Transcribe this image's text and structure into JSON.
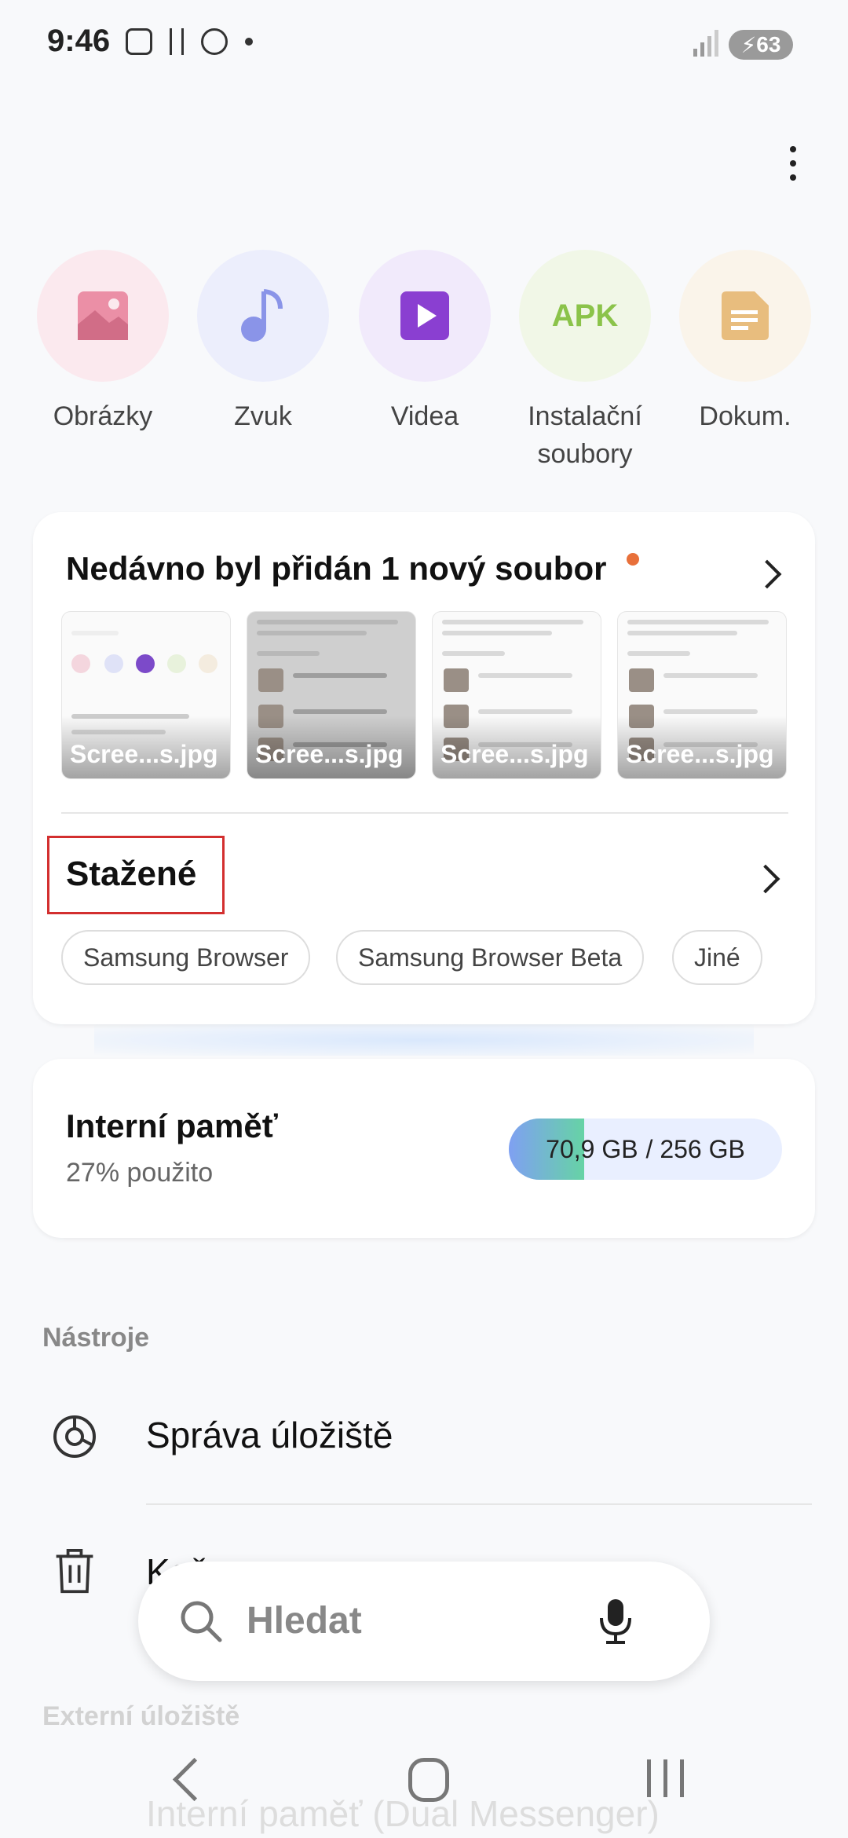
{
  "status_bar": {
    "time": "9:46",
    "battery": "63"
  },
  "categories": [
    {
      "label": "Obrázky",
      "icon": "image-icon",
      "bg": "#fbe9ee",
      "color": "#e8869c"
    },
    {
      "label": "Zvuk",
      "icon": "music-note-icon",
      "bg": "#eceefc",
      "color": "#8a94e8"
    },
    {
      "label": "Videa",
      "icon": "video-icon",
      "bg": "#f1eafb",
      "color": "#8a3fd1"
    },
    {
      "label": "Instalační\nsoubory",
      "icon": "apk-icon",
      "apk_text": "APK",
      "bg": "#f1f7e7",
      "color": "#8bc34a"
    },
    {
      "label": "Dokum.",
      "icon": "document-icon",
      "bg": "#faf4ea",
      "color": "#e8bd7e"
    }
  ],
  "recent": {
    "title": "Nedávno byl přidán 1 nový soubor",
    "thumbs": [
      {
        "caption": "Scree...s.jpg"
      },
      {
        "caption": "Scree...s.jpg"
      },
      {
        "caption": "Scree...s.jpg"
      },
      {
        "caption": "Scree...s.jpg"
      }
    ]
  },
  "downloads": {
    "title": "Stažené",
    "chips": [
      "Samsung Browser",
      "Samsung Browser Beta",
      "Jiné"
    ]
  },
  "storage": {
    "title": "Interní paměť",
    "subtitle": "27% použito",
    "used": "70,9 GB",
    "total": "/ 256 GB",
    "used_fraction": 0.277
  },
  "tools": {
    "section_label": "Nástroje",
    "items": [
      {
        "label": "Správa úložiště",
        "icon": "storage-manager-icon"
      },
      {
        "label": "Koš",
        "icon": "trash-icon"
      }
    ]
  },
  "external": {
    "section_label": "Externí úložiště",
    "items": [
      {
        "label": "Interní paměť (Dual Messenger)"
      }
    ]
  },
  "search": {
    "placeholder": "Hledat"
  }
}
